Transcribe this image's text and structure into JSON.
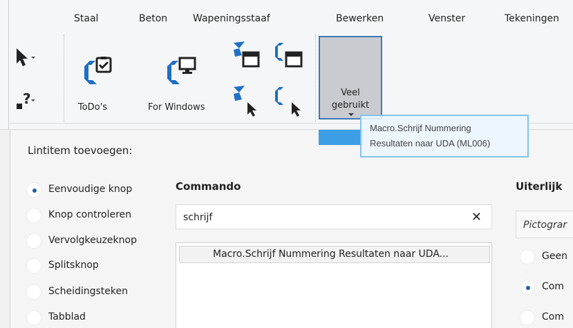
{
  "tabs": [
    "Staal",
    "Beton",
    "Wapeningsstaaf",
    "Bewerken",
    "Venster",
    "Tekeningen"
  ],
  "ribbon": {
    "todos_label": "ToDo's",
    "forwindows_label": "For Windows",
    "veel_line1": "Veel",
    "veel_line2": "gebruikt"
  },
  "tooltip": {
    "line1": "Macro.Schrijf Nummering",
    "line2": "Resultaten naar UDA (ML006)"
  },
  "lintitem": {
    "title": "Lintitem toevoegen:",
    "options": [
      {
        "label": "Eenvoudige knop",
        "checked": true
      },
      {
        "label": "Knop controleren",
        "checked": false
      },
      {
        "label": "Vervolgkeuzeknop",
        "checked": false
      },
      {
        "label": "Splitsknop",
        "checked": false
      },
      {
        "label": "Scheidingsteken",
        "checked": false
      },
      {
        "label": "Tabblad",
        "checked": false
      }
    ]
  },
  "commando": {
    "title": "Commando",
    "search_value": "schrijf",
    "clear_glyph": "✕",
    "results": [
      "Macro.Schrijf Nummering Resultaten naar UDA..."
    ]
  },
  "uiterlijk": {
    "title": "Uiterlijk",
    "picto_text": "Pictograr",
    "options": [
      {
        "label": "Geen",
        "checked": false
      },
      {
        "label": "Com",
        "checked": true
      },
      {
        "label": "Com",
        "checked": false
      }
    ]
  },
  "colors": {
    "accent": "#1f5fa8",
    "icon_blue": "#1f6fc5",
    "highlight": "#3c9ee4"
  }
}
